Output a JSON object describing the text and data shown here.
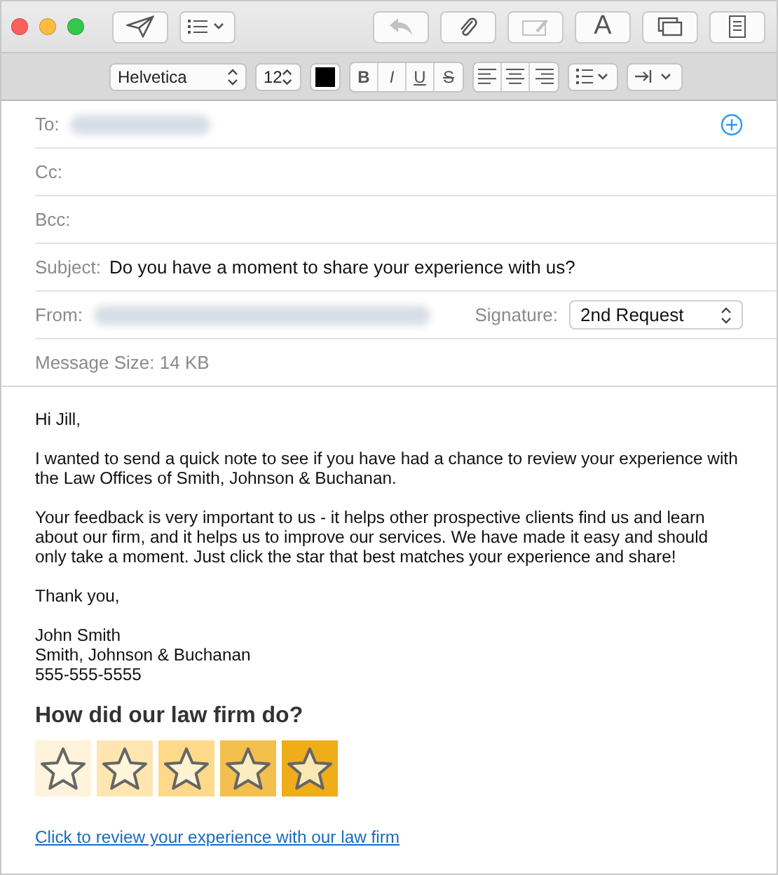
{
  "toolbar": {
    "buttons": [
      {
        "kind": "send",
        "disabled": false
      },
      {
        "kind": "list",
        "disabled": false
      },
      {
        "kind": "reply",
        "disabled": true
      },
      {
        "kind": "attach",
        "disabled": false
      },
      {
        "kind": "markup",
        "disabled": true
      },
      {
        "kind": "font",
        "label": "A",
        "disabled": false
      },
      {
        "kind": "window",
        "disabled": false
      },
      {
        "kind": "template",
        "disabled": false
      }
    ]
  },
  "format_bar": {
    "font": "Helvetica",
    "size": "12",
    "styles": [
      "B",
      "I",
      "U",
      "S"
    ]
  },
  "header": {
    "to_label": "To:",
    "cc_label": "Cc:",
    "bcc_label": "Bcc:",
    "subject_label": "Subject:",
    "subject": "Do you have a moment to share your experience with us?",
    "from_label": "From:",
    "signature_label": "Signature:",
    "signature": "2nd Request",
    "message_size": "Message Size: 14 KB"
  },
  "body": {
    "greeting": "Hi Jill,",
    "paragraphs": [
      "I wanted to send a quick note to see if you have had a chance to review your experience with the Law Offices of Smith, Johnson & Buchanan.",
      "Your feedback is very important to us - it helps other prospective clients find us and learn about our firm, and it helps us to improve our services. We have made it easy and should only take a moment. Just click the star that best matches your experience and share!"
    ],
    "closing": "Thank you,",
    "signature_lines": [
      "John Smith",
      "Smith, Johnson & Buchanan",
      "555-555-5555"
    ],
    "rating_title": "How did our law firm do?",
    "rating_buttons": [
      {
        "color": "#fff3dc"
      },
      {
        "color": "#ffe6b0"
      },
      {
        "color": "#fed98a"
      },
      {
        "color": "#f3c04e"
      },
      {
        "color": "#efad1a"
      }
    ],
    "link": "Click to review your experience with our law firm"
  }
}
